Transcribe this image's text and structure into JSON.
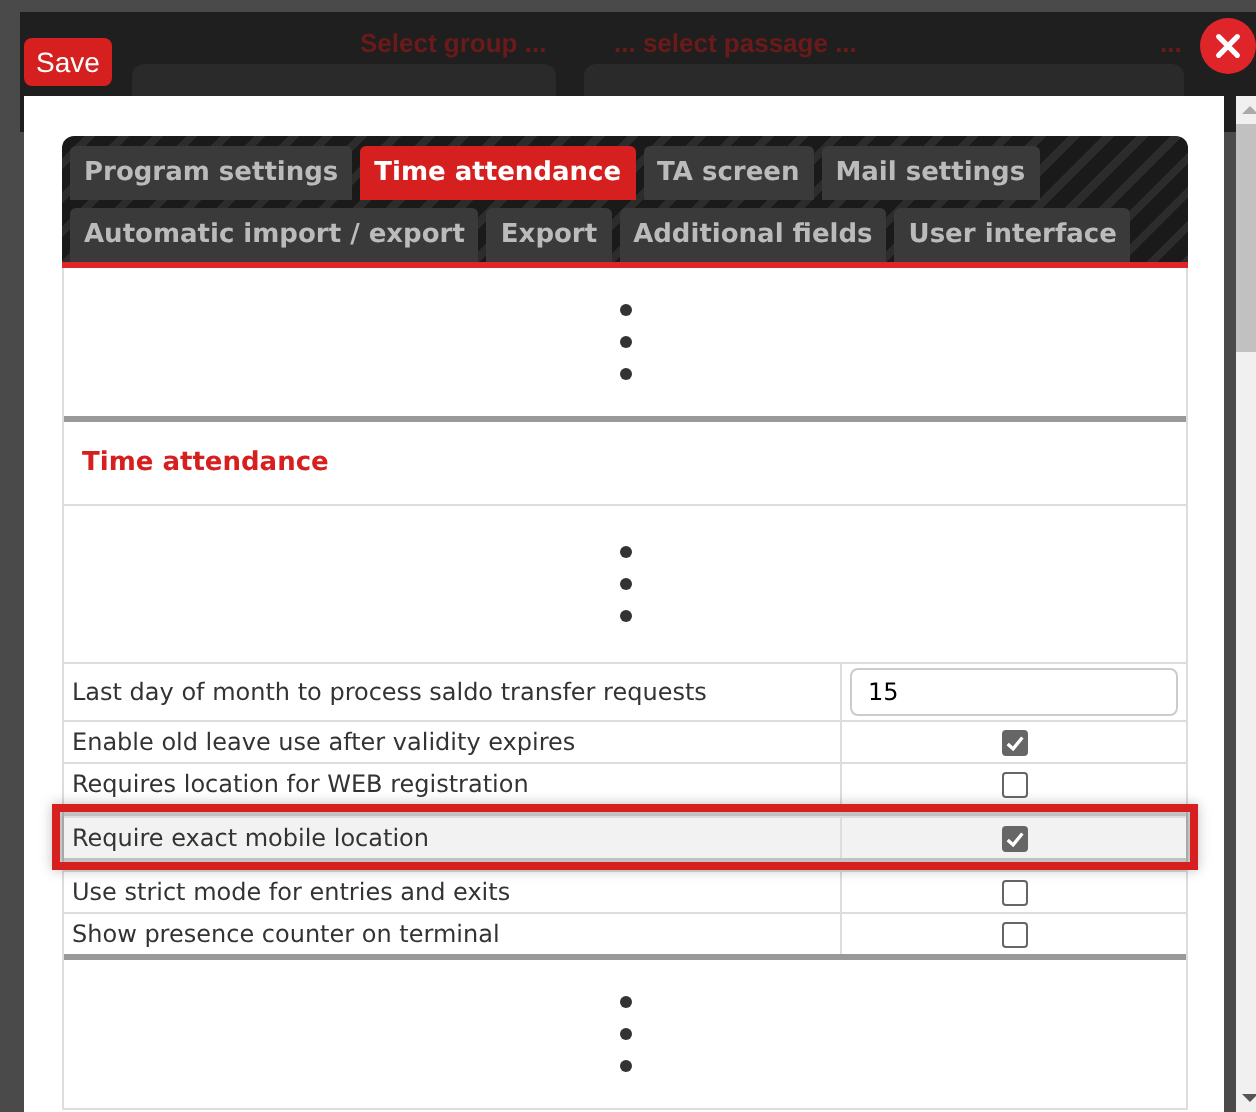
{
  "background": {
    "group_label": "Select group ...",
    "passage_label": "... select passage ...",
    "third_label": "..."
  },
  "save_button": "Save",
  "tabs": [
    {
      "label": "Program settings",
      "selected": false
    },
    {
      "label": "Time attendance",
      "selected": true
    },
    {
      "label": "TA screen",
      "selected": false
    },
    {
      "label": "Mail settings",
      "selected": false
    },
    {
      "label": "Automatic import / export",
      "selected": false
    },
    {
      "label": "Export",
      "selected": false
    },
    {
      "label": "Additional fields",
      "selected": false
    },
    {
      "label": "User interface",
      "selected": false
    }
  ],
  "section_title": "Time attendance",
  "settings": [
    {
      "kind": "number",
      "label": "Last day of month to process saldo transfer requests",
      "value": "15",
      "highlighted": false
    },
    {
      "kind": "checkbox",
      "label": "Enable old leave use after validity expires",
      "checked": true,
      "highlighted": false
    },
    {
      "kind": "checkbox",
      "label": "Requires location for WEB registration",
      "checked": false,
      "highlighted": false
    },
    {
      "kind": "checkbox",
      "label": "Require exact mobile location",
      "checked": true,
      "highlighted": true
    },
    {
      "kind": "checkbox",
      "label": "Use strict mode for entries and exits",
      "checked": false,
      "highlighted": false
    },
    {
      "kind": "checkbox",
      "label": "Show presence counter on terminal",
      "checked": false,
      "highlighted": false
    }
  ]
}
